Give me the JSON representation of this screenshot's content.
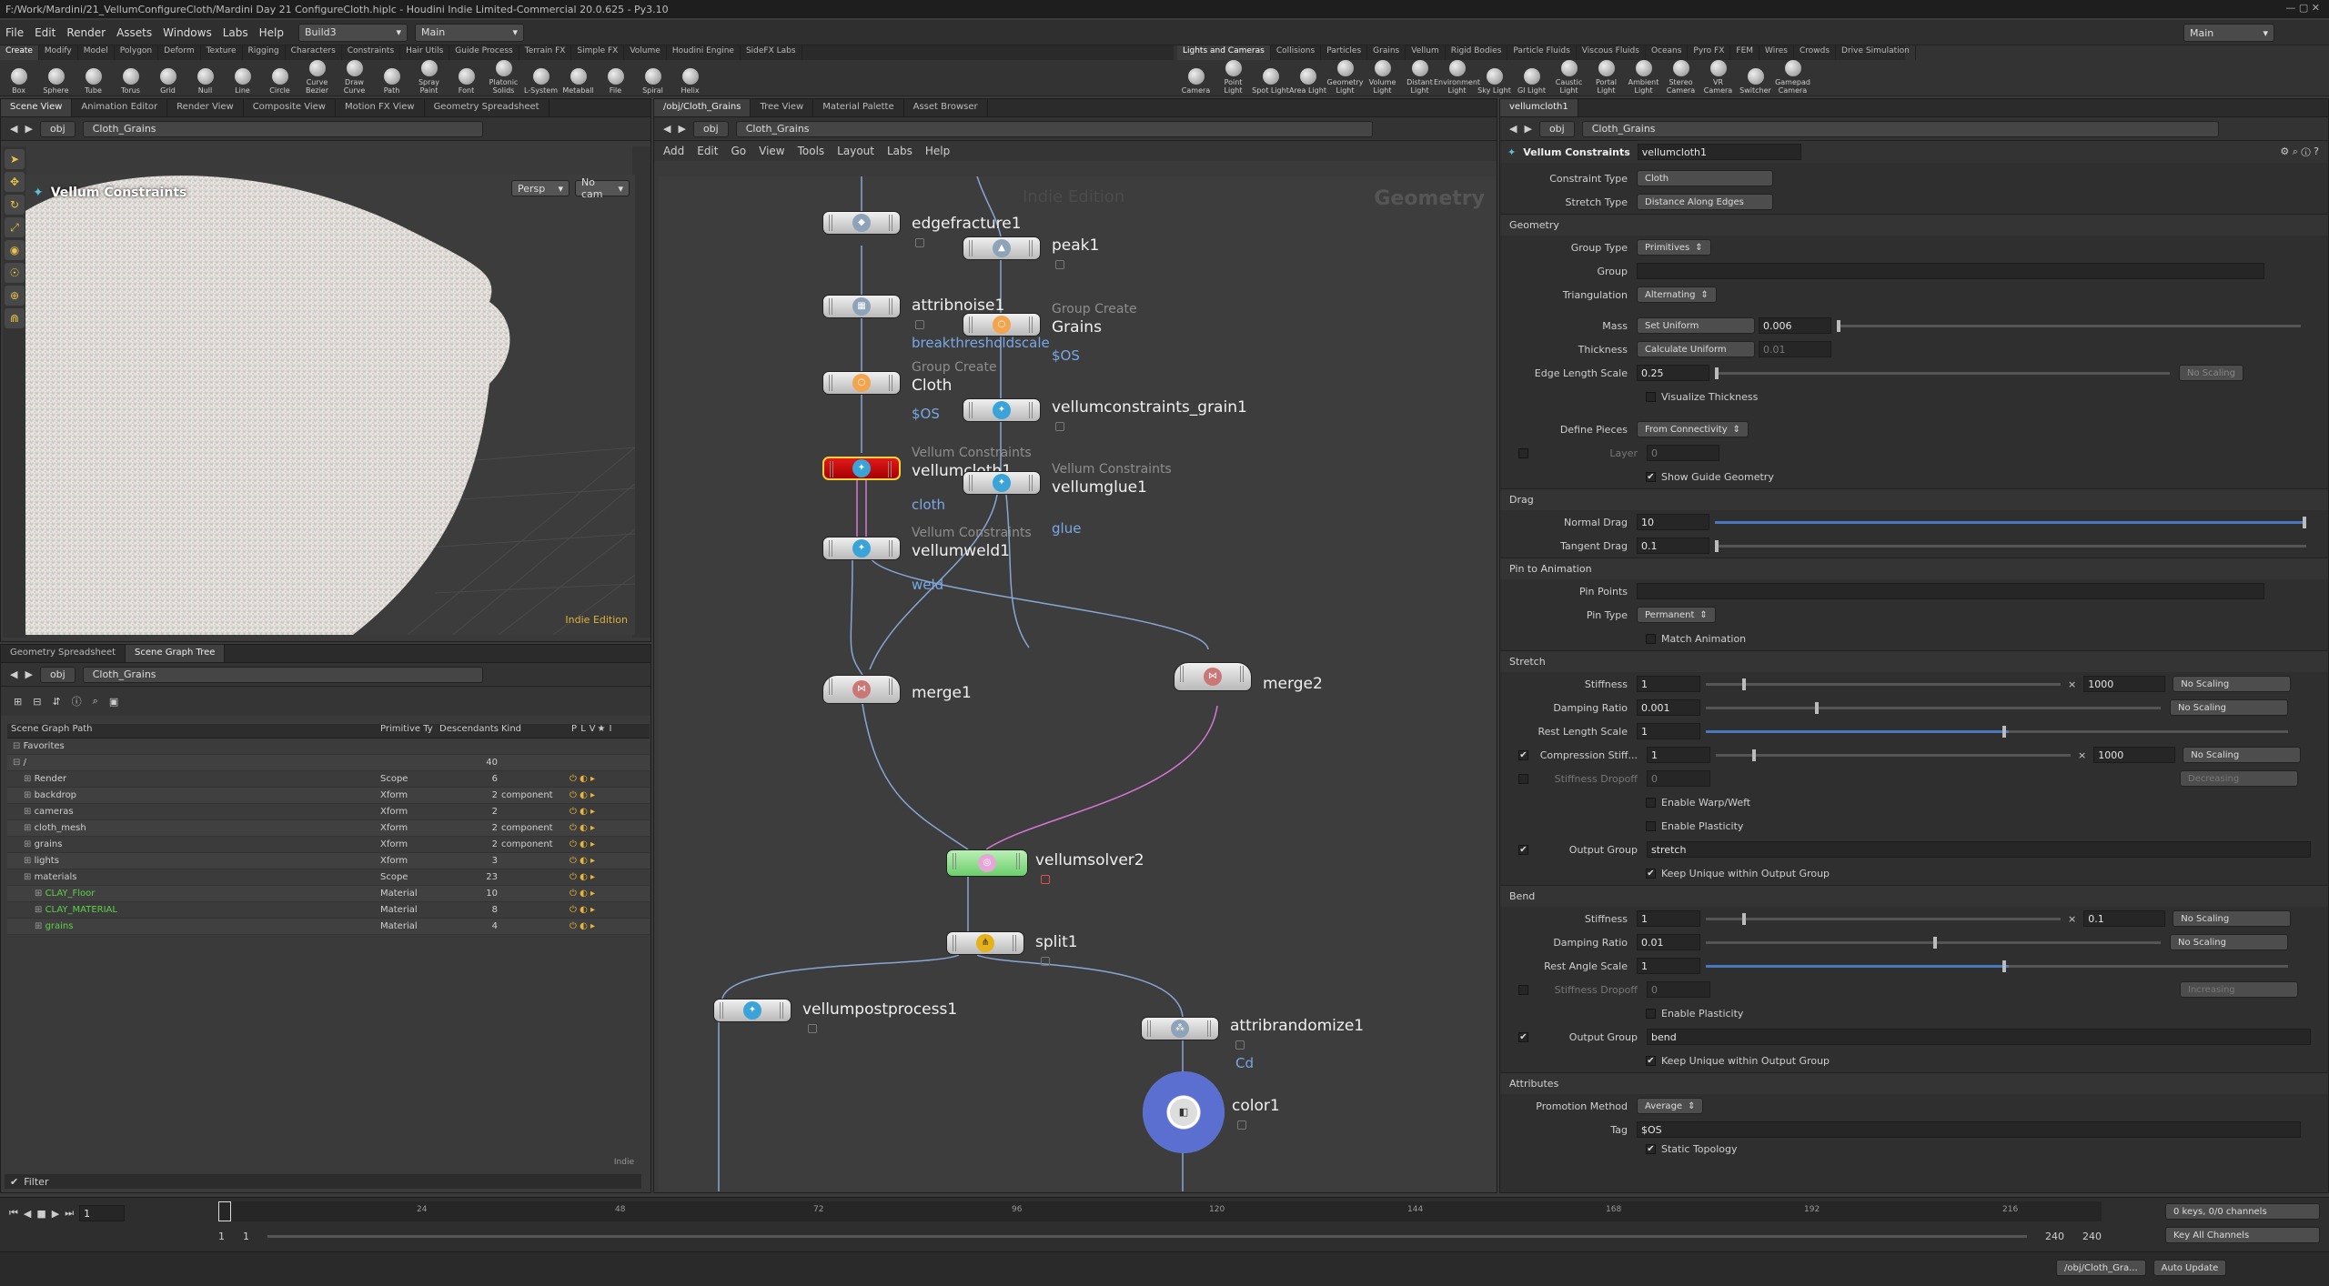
{
  "window": {
    "title": "F:/Work/Mardini/21_VellumConfigureCloth/Mardini Day 21 ConfigureCloth.hiplc - Houdini Indie Limited-Commercial 20.0.625 - Py3.10"
  },
  "menu": {
    "items": [
      "File",
      "Edit",
      "Render",
      "Assets",
      "Windows",
      "Labs",
      "Help"
    ],
    "build": "Build3",
    "desktop": "Main",
    "right_desktop": "Main"
  },
  "shelf_left": {
    "tabs": [
      "Create",
      "Modify",
      "Model",
      "Polygon",
      "Deform",
      "Texture",
      "Rigging",
      "Characters",
      "Constraints",
      "Hair Utils",
      "Guide Process",
      "Terrain FX",
      "Simple FX",
      "Volume",
      "Houdini Engine",
      "SideFX Labs"
    ],
    "tools": [
      "Box",
      "Sphere",
      "Tube",
      "Torus",
      "Grid",
      "Null",
      "Line",
      "Circle",
      "Curve Bezier",
      "Draw Curve",
      "Path",
      "Spray Paint",
      "Font",
      "Platonic Solids",
      "L-System",
      "Metaball",
      "File",
      "Spiral",
      "Helix"
    ]
  },
  "shelf_right": {
    "tabs": [
      "Lights and Cameras",
      "Collisions",
      "Particles",
      "Grains",
      "Vellum",
      "Rigid Bodies",
      "Particle Fluids",
      "Viscous Fluids",
      "Oceans",
      "Pyro FX",
      "FEM",
      "Wires",
      "Crowds",
      "Drive Simulation"
    ],
    "tools": [
      "Camera",
      "Point Light",
      "Spot Light",
      "Area Light",
      "Geometry Light",
      "Volume Light",
      "Distant Light",
      "Environment Light",
      "Sky Light",
      "GI Light",
      "Caustic Light",
      "Portal Light",
      "Ambient Light",
      "Stereo Camera",
      "VR Camera",
      "Switcher",
      "Gamepad Camera"
    ]
  },
  "left_top": {
    "tabs": [
      "Scene View",
      "Animation Editor",
      "Render View",
      "Composite View",
      "Motion FX View",
      "Geometry Spreadsheet"
    ],
    "path": [
      "obj",
      "Cloth_Grains"
    ],
    "viewport": {
      "label": "Vellum Constraints",
      "camera": "Persp",
      "cam": "No cam",
      "watermark": "Indie Edition"
    }
  },
  "left_bottom": {
    "tabs": [
      "Geometry Spreadsheet",
      "Scene Graph Tree"
    ],
    "path": [
      "obj",
      "Cloth_Grains"
    ],
    "columns": [
      "Scene Graph Path",
      "Primitive Ty",
      "Descendants",
      "Kind",
      "P",
      "L",
      "V",
      "★",
      "I"
    ],
    "rows": [
      {
        "name": "Favorites",
        "type": "",
        "desc": "",
        "kind": "",
        "depth": 0
      },
      {
        "name": "/",
        "type": "",
        "desc": "40",
        "kind": "",
        "depth": 0
      },
      {
        "name": "Render",
        "type": "Scope",
        "desc": "6",
        "kind": "",
        "depth": 1
      },
      {
        "name": "backdrop",
        "type": "Xform",
        "desc": "2",
        "kind": "component",
        "depth": 1
      },
      {
        "name": "cameras",
        "type": "Xform",
        "desc": "2",
        "kind": "",
        "depth": 1
      },
      {
        "name": "cloth_mesh",
        "type": "Xform",
        "desc": "2",
        "kind": "component",
        "depth": 1
      },
      {
        "name": "grains",
        "type": "Xform",
        "desc": "2",
        "kind": "component",
        "depth": 1
      },
      {
        "name": "lights",
        "type": "Xform",
        "desc": "3",
        "kind": "",
        "depth": 1
      },
      {
        "name": "materials",
        "type": "Scope",
        "desc": "23",
        "kind": "",
        "depth": 1
      },
      {
        "name": "CLAY_Floor",
        "type": "Material",
        "desc": "10",
        "kind": "",
        "depth": 2,
        "green": true
      },
      {
        "name": "CLAY_MATERIAL",
        "type": "Material",
        "desc": "8",
        "kind": "",
        "depth": 2,
        "green": true
      },
      {
        "name": "grains",
        "type": "Material",
        "desc": "4",
        "kind": "",
        "depth": 2,
        "green": true
      }
    ],
    "filter": "Filter",
    "indie": "Indie"
  },
  "network": {
    "tabs": [
      "/obj/Cloth_Grains",
      "Tree View",
      "Material Palette",
      "Asset Browser"
    ],
    "path": [
      "obj",
      "Cloth_Grains"
    ],
    "menu": [
      "Add",
      "Edit",
      "Go",
      "View",
      "Tools",
      "Layout",
      "Labs",
      "Help"
    ],
    "watermark": "Indie Edition",
    "context": "Geometry",
    "nodes": {
      "edgefracture1": {
        "name": "edgefracture1"
      },
      "attribnoise1": {
        "name": "attribnoise1",
        "group": "breakthresholdscale"
      },
      "cloth": {
        "type": "Group Create",
        "name": "Cloth",
        "group": "$OS"
      },
      "vellumcloth1": {
        "type": "Vellum Constraints",
        "name": "vellumcloth1",
        "group": "cloth"
      },
      "vellumweld1": {
        "type": "Vellum Constraints",
        "name": "vellumweld1",
        "group": "weld"
      },
      "peak1": {
        "name": "peak1"
      },
      "grains": {
        "type": "Group Create",
        "name": "Grains",
        "group": "$OS"
      },
      "vcgrain": {
        "name": "vellumconstraints_grain1"
      },
      "vellumglue1": {
        "type": "Vellum Constraints",
        "name": "vellumglue1",
        "group": "glue"
      },
      "merge1": {
        "name": "merge1"
      },
      "merge2": {
        "name": "merge2"
      },
      "vellumsolver2": {
        "name": "vellumsolver2"
      },
      "split1": {
        "name": "split1"
      },
      "vellumpostprocess1": {
        "name": "vellumpostprocess1"
      },
      "attribrandomize1": {
        "name": "attribrandomize1",
        "group": "Cd"
      },
      "color1": {
        "name": "color1"
      }
    }
  },
  "params": {
    "tab": "vellumcloth1",
    "path": [
      "obj",
      "Cloth_Grains"
    ],
    "node_type": "Vellum Constraints",
    "node_name": "vellumcloth1",
    "constraint_type": {
      "label": "Constraint Type",
      "value": "Cloth"
    },
    "stretch_type": {
      "label": "Stretch Type",
      "value": "Distance Along Edges"
    },
    "geometry": {
      "title": "Geometry",
      "group_type_label": "Group Type",
      "group_type": "Primitives",
      "group_label": "Group",
      "group": "",
      "triangulation_label": "Triangulation",
      "triangulation": "Alternating",
      "mass_label": "Mass",
      "mass_mode": "Set Uniform",
      "mass": "0.006",
      "thickness_label": "Thickness",
      "thickness_mode": "Calculate Uniform",
      "thickness": "0.01",
      "edge_scale_label": "Edge Length Scale",
      "edge_scale": "0.25",
      "edge_scaling": "No Scaling",
      "visualize": "Visualize Thickness",
      "define_pieces_label": "Define Pieces",
      "define_pieces": "From Connectivity",
      "layer_label": "Layer",
      "layer": "0",
      "show_guide": "Show Guide Geometry"
    },
    "drag": {
      "title": "Drag",
      "normal_label": "Normal Drag",
      "normal": "10",
      "tangent_label": "Tangent Drag",
      "tangent": "0.1"
    },
    "pin": {
      "title": "Pin to Animation",
      "points_label": "Pin Points",
      "points": "",
      "type_label": "Pin Type",
      "type": "Permanent",
      "match": "Match Animation"
    },
    "stretch": {
      "title": "Stretch",
      "stiffness_label": "Stiffness",
      "stiffness": "1",
      "stiffness_mult": "1000",
      "stiffness_scaling": "No Scaling",
      "damping_label": "Damping Ratio",
      "damping": "0.001",
      "damping_scaling": "No Scaling",
      "rest_label": "Rest Length Scale",
      "rest": "1",
      "comp_label": "Compression Stiff...",
      "comp": "1",
      "comp_mult": "1000",
      "comp_scaling": "No Scaling",
      "dropoff_label": "Stiffness Dropoff",
      "dropoff": "0",
      "dropoff_mode": "Decreasing",
      "warp": "Enable Warp/Weft",
      "plasticity": "Enable Plasticity",
      "out_label": "Output Group",
      "out": "stretch",
      "keep": "Keep Unique within Output Group"
    },
    "bend": {
      "title": "Bend",
      "stiffness_label": "Stiffness",
      "stiffness": "1",
      "stiffness_mult": "0.1",
      "stiffness_scaling": "No Scaling",
      "damping_label": "Damping Ratio",
      "damping": "0.01",
      "damping_scaling": "No Scaling",
      "rest_label": "Rest Angle Scale",
      "rest": "1",
      "dropoff_label": "Stiffness Dropoff",
      "dropoff": "0",
      "dropoff_mode": "Increasing",
      "plasticity": "Enable Plasticity",
      "out_label": "Output Group",
      "out": "bend",
      "keep": "Keep Unique within Output Group"
    },
    "attributes": {
      "title": "Attributes",
      "promo_label": "Promotion Method",
      "promo": "Average",
      "tag_label": "Tag",
      "tag": "$OS",
      "static": "Static Topology"
    }
  },
  "timeline": {
    "frame": "1",
    "ticks": [
      "24",
      "48",
      "72",
      "96",
      "120",
      "144",
      "168",
      "192",
      "216"
    ],
    "start": "1",
    "start2": "1",
    "end": "240",
    "end2": "240",
    "keys": "0 keys, 0/0 channels",
    "key_all": "Key All Channels"
  },
  "status": {
    "path": "/obj/Cloth_Gra...",
    "update": "Auto Update"
  }
}
